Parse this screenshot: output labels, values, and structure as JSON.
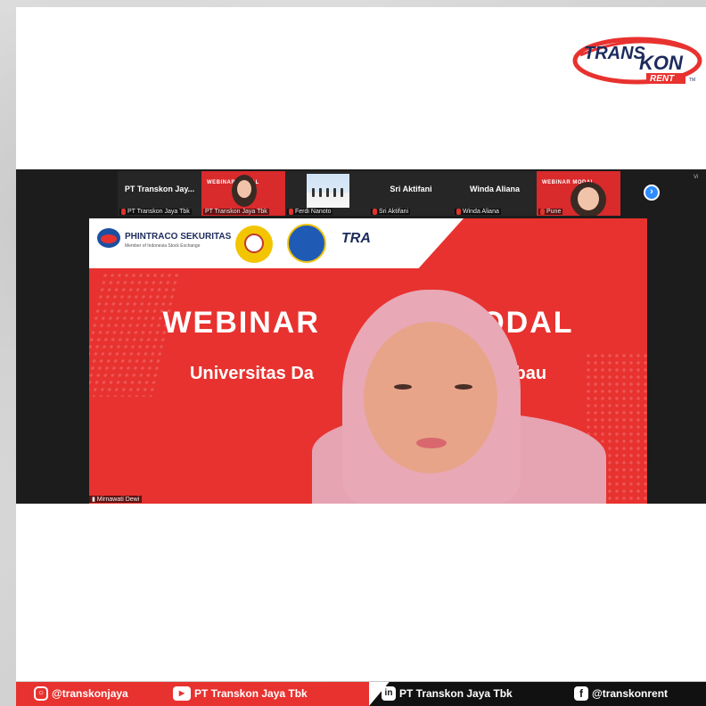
{
  "brand": {
    "logo_line1": "TRANS",
    "logo_line2": "KON",
    "logo_sub": "RENT",
    "logo_tm": "TM",
    "colors": {
      "red": "#e8322f",
      "navy": "#1d2b5c",
      "zoom_bg": "#1c1c1c"
    }
  },
  "zoom": {
    "view_label": "Vi",
    "participants": [
      {
        "tile_name": "PT Transkon Jay...",
        "footer": "PT Transkon Jaya Tbk",
        "type": "name"
      },
      {
        "tile_name": "WEBINAR    MODAL",
        "footer": "PT Transkon Jaya Tbk",
        "type": "video"
      },
      {
        "tile_name": "",
        "footer": "Ferdi Nanoto",
        "type": "photo"
      },
      {
        "tile_name": "Sri Aktifani",
        "footer": "Sri Aktifani",
        "type": "name"
      },
      {
        "tile_name": "Winda Aliana",
        "footer": "Winda Aliana",
        "type": "name"
      },
      {
        "tile_name": "WEBINAR    MODAL",
        "footer": "Pune",
        "type": "video"
      }
    ],
    "next_icon": "chevron-right-icon",
    "speaker_name": "Mirnawati Dewi"
  },
  "slide": {
    "org_name": "PHINTRACO SEKURITAS",
    "org_sub": "Member of Indonesia Stock Exchange",
    "banner_trans": "TRA",
    "title_left": "WEBINAR",
    "title_right": "MODAL",
    "subtitle_left": "Universitas Da",
    "subtitle_right": "n Baubau"
  },
  "footer": {
    "instagram": "@transkonjaya",
    "youtube": "PT Transkon Jaya Tbk",
    "linkedin": "PT Transkon Jaya Tbk",
    "facebook": "@transkonrent"
  }
}
